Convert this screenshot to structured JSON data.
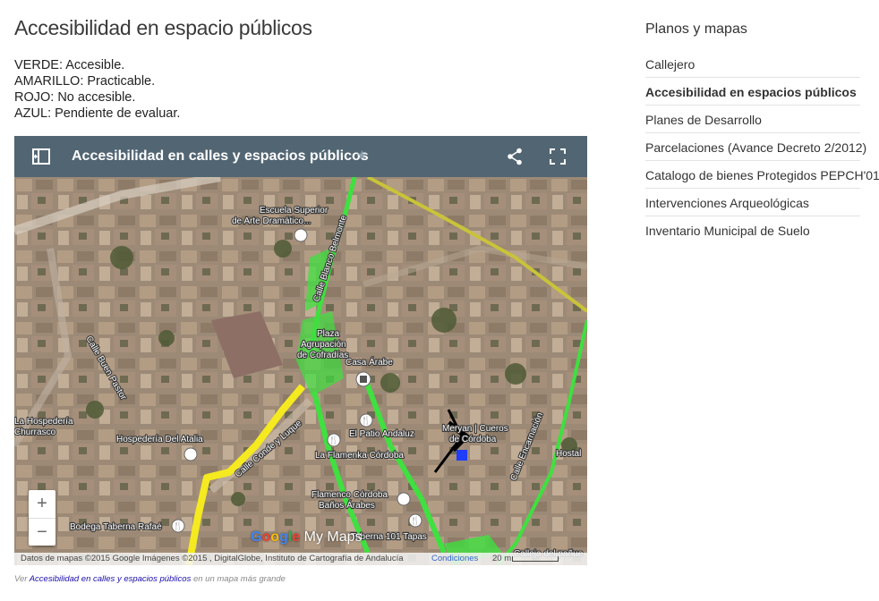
{
  "page": {
    "title": "Accesibilidad en espacio públicos",
    "legend": [
      "VERDE: Accesible.",
      "AMARILLO: Practicable.",
      "ROJO: No accesible.",
      "AZUL: Pendiente de evaluar."
    ]
  },
  "map": {
    "title": "Accesibilidad en calles y espacios públicos",
    "header_icons": {
      "sidebar": "sidebar-toggle-icon",
      "star": "star-icon",
      "share": "share-icon",
      "fullscreen": "fullscreen-icon"
    },
    "labels": {
      "escuela_1": "Escuela Superior",
      "escuela_2": "de Arte Dramático...",
      "plaza_1": "Plaza",
      "plaza_2": "Agrupación",
      "plaza_3": "de Cofradías",
      "casa_arabe": "Casa Árabe",
      "calle_buen_pastor": "Calle Buen Pastor",
      "hospederia_1": "La Hospedería",
      "hospederia_2": "Churrasco",
      "hospederia_atalia": "Hospedería Del Atalia",
      "patio_andaluz": "El Patio Andaluz",
      "flamenka": "La Flamenka Córdoba",
      "meryan_1": "Meryan | Cueros",
      "meryan_2": "de Córdoba",
      "hostal": "Hostal",
      "flamenco_1": "Flamenco Córdoba",
      "flamenco_2": "Baños Árabes",
      "bodega": "Bodega Taberna Rafaé",
      "taberna": "Taberna 101 Tapas",
      "calle_encarnacion": "Calle Encarnación",
      "calle_panuelo": "Calleja del pañue",
      "calle_blanco": "Calle Blanco Belmonte",
      "calle_conde": "Calle Conde y Luque"
    },
    "zoom_in": "+",
    "zoom_out": "−",
    "brand_google": [
      "G",
      "o",
      "o",
      "g",
      "l",
      "e"
    ],
    "brand_mymaps": "My Maps",
    "attribution": "Datos de mapas ©2015 Google Imágenes ©2015 , DigitalGlobe, Instituto de Cartografía de Andalucía",
    "terms": "Condiciones",
    "scale": "20 m",
    "colors": {
      "green": "#3fe03f",
      "yellow": "#f4ea1f",
      "blue": "#1f3cff",
      "header": "#526573"
    }
  },
  "caption": {
    "prefix": "Ver ",
    "link": "Accesibilidad en calles y espacios públicos",
    "suffix": " en un mapa más grande"
  },
  "sidebar": {
    "title": "Planos y mapas",
    "items": [
      {
        "label": "Callejero",
        "active": false
      },
      {
        "label": "Accesibilidad en espacios públicos",
        "active": true
      },
      {
        "label": "Planes de Desarrollo",
        "active": false
      },
      {
        "label": "Parcelaciones (Avance Decreto 2/2012)",
        "active": false
      },
      {
        "label": "Catalogo de bienes Protegidos PEPCH'01",
        "active": false
      },
      {
        "label": "Intervenciones Arqueológicas",
        "active": false
      },
      {
        "label": "Inventario Municipal de Suelo",
        "active": false
      }
    ]
  }
}
